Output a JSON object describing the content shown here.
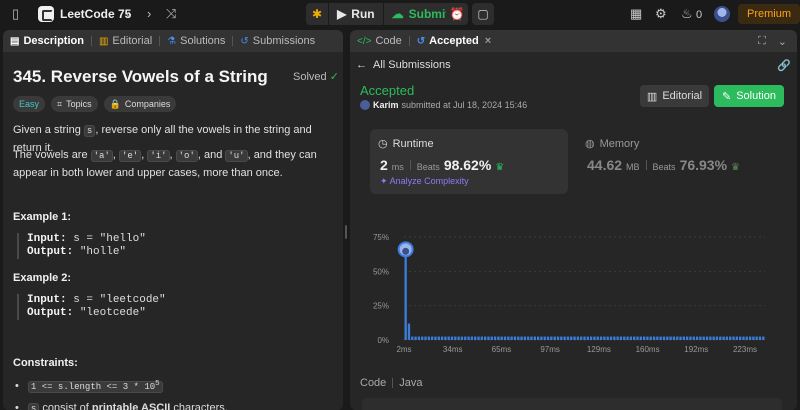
{
  "topbar": {
    "app_title": "LeetCode 75",
    "run_label": "Run",
    "submit_label": "Submit",
    "fire_count": "0",
    "premium_label": "Premium"
  },
  "left": {
    "tabs": [
      {
        "label": "Description"
      },
      {
        "label": "Editorial"
      },
      {
        "label": "Solutions"
      },
      {
        "label": "Submissions"
      }
    ],
    "title": "345. Reverse Vowels of a String",
    "solved_label": "Solved",
    "chips": {
      "difficulty": "Easy",
      "topics": "Topics",
      "companies": "Companies"
    },
    "desc1": {
      "pre": "Given a string ",
      "code": "s",
      "post": ", reverse only all the vowels in the string and return it."
    },
    "desc2": {
      "pre": "The vowels are ",
      "v1": "'a'",
      "v2": "'e'",
      "v3": "'i'",
      "v4": "'o'",
      "and": ", and ",
      "v5": "'u'",
      "post": ", and they can appear in both lower and upper cases, more than once."
    },
    "example1": {
      "title": "Example 1:",
      "input_label": "Input:",
      "input": "s = \"hello\"",
      "output_label": "Output:",
      "output": "\"holle\""
    },
    "example2": {
      "title": "Example 2:",
      "input_label": "Input:",
      "input": "s = \"leetcode\"",
      "output_label": "Output:",
      "output": "\"leotcede\""
    },
    "constraints_title": "Constraints:",
    "constraint1": "1 <= s.length <= 3 * 10",
    "constraint1_exp": "5",
    "constraint2_code": "s",
    "constraint2_pre": " consist of ",
    "constraint2_bold": "printable ASCII",
    "constraint2_post": " characters."
  },
  "right": {
    "tabs": [
      {
        "label": "Code"
      },
      {
        "label": "Accepted"
      }
    ],
    "back_label": "All Submissions",
    "status": "Accepted",
    "submitter": "Karim",
    "submitted_text": "submitted at Jul 18, 2024 15:46",
    "editorial_btn": "Editorial",
    "solution_btn": "Solution",
    "runtime": {
      "label": "Runtime",
      "value": "2",
      "unit": "ms",
      "beats_label": "Beats",
      "beats": "98.62%"
    },
    "analyze_label": "Analyze Complexity",
    "memory": {
      "label": "Memory",
      "value": "44.62",
      "unit": "MB",
      "beats_label": "Beats",
      "beats": "76.93%"
    },
    "code_label": "Code",
    "language": "Java"
  },
  "chart_data": {
    "type": "bar",
    "title": "",
    "xlabel": "",
    "ylabel": "",
    "y_ticks": [
      "75%",
      "50%",
      "25%",
      "0%"
    ],
    "x_ticks": [
      "2ms",
      "34ms",
      "65ms",
      "97ms",
      "129ms",
      "160ms",
      "192ms",
      "223ms"
    ],
    "ylim": [
      0,
      75
    ],
    "selected_bin": 0,
    "values": [
      66,
      12,
      2.5,
      2.5,
      2.5,
      2.5,
      2.5,
      2.5,
      2.5,
      2.5,
      2.5,
      2.5,
      2.5,
      2.5,
      2.5,
      2.5,
      2.5,
      2.5,
      2.5,
      2.5,
      2.5,
      2.5,
      2.5,
      2.5,
      2.5,
      2.5,
      2.5,
      2.5,
      2.5,
      2.5,
      2.5,
      2.5,
      2.5,
      2.5,
      2.5,
      2.5,
      2.5,
      2.5,
      2.5,
      2.5,
      2.5,
      2.5,
      2.5,
      2.5,
      2.5,
      2.5,
      2.5,
      2.5,
      2.5,
      2.5,
      2.5,
      2.5,
      2.5,
      2.5,
      2.5,
      2.5,
      2.5,
      2.5,
      2.5,
      2.5,
      2.5,
      2.5,
      2.5,
      2.5,
      2.5,
      2.5,
      2.5,
      2.5,
      2.5,
      2.5,
      2.5,
      2.5,
      2.5,
      2.5,
      2.5,
      2.5,
      2.5,
      2.5,
      2.5,
      2.5,
      2.5,
      2.5,
      2.5,
      2.5,
      2.5,
      2.5,
      2.5,
      2.5,
      2.5,
      2.5,
      2.5,
      2.5,
      2.5,
      2.5,
      2.5,
      2.5,
      2.5,
      2.5,
      2.5,
      2.5,
      2.5,
      2.5,
      2.5,
      2.5,
      2.5,
      2.5,
      2.5,
      2.5,
      2.5
    ],
    "bar_color": "#3b7ddd"
  },
  "colors": {
    "accent_green": "#2cbb5d",
    "premium": "#ffa116",
    "easy": "#46c6c2",
    "analyze": "#8b7cf6"
  }
}
